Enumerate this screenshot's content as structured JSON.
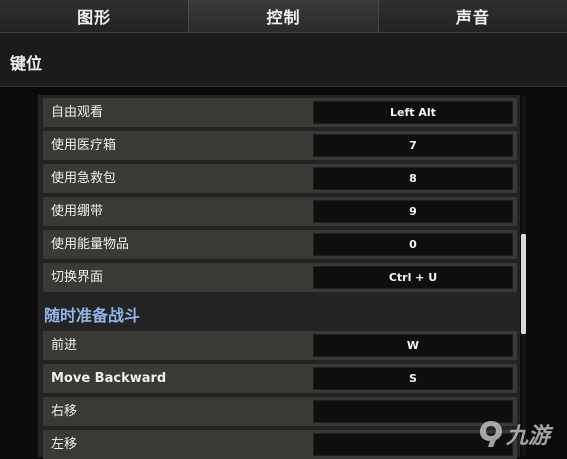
{
  "tabs": [
    {
      "label": "图形"
    },
    {
      "label": "控制"
    },
    {
      "label": "声音"
    }
  ],
  "section": {
    "title": "键位"
  },
  "keybinds": [
    {
      "action": "自由观看",
      "key": "Left Alt"
    },
    {
      "action": "使用医疗箱",
      "key": "7"
    },
    {
      "action": "使用急救包",
      "key": "8"
    },
    {
      "action": "使用绷带",
      "key": "9"
    },
    {
      "action": "使用能量物品",
      "key": "0"
    },
    {
      "action": "切换界面",
      "key": "Ctrl + U"
    }
  ],
  "group2": {
    "title": "随时准备战斗",
    "keybinds": [
      {
        "action": "前进",
        "key": "W"
      },
      {
        "action": "Move Backward",
        "key": "S"
      },
      {
        "action": "右移",
        "key": ""
      },
      {
        "action": "左移",
        "key": ""
      }
    ]
  },
  "watermark": {
    "text": "九游",
    "icon": "jiuyou-logo-icon"
  }
}
